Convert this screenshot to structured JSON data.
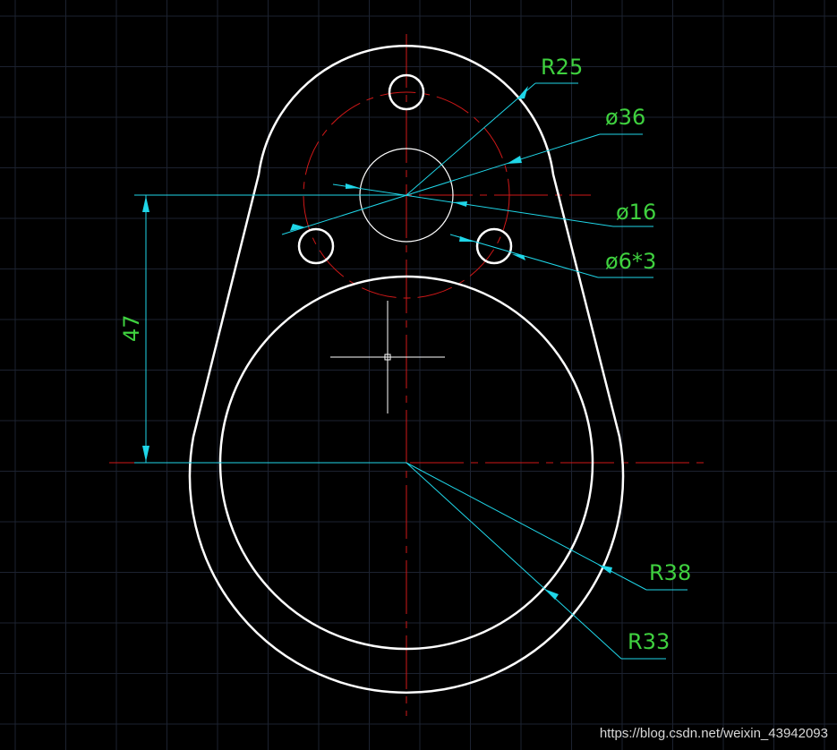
{
  "colors": {
    "background": "#000000",
    "grid": "#1c2230",
    "geometry": "#ffffff",
    "centerline": "#d01818",
    "dimension": "#1fd6e8",
    "dimension_text": "#3fd13f"
  },
  "dimensions": {
    "r25": "R25",
    "d36": "ø36",
    "d16": "ø16",
    "d6x3": "ø6*3",
    "d47": "47",
    "r38": "R38",
    "r33": "R33"
  },
  "watermark": "https://blog.csdn.net/weixin_43942093",
  "cursor": "crosshair-icon"
}
